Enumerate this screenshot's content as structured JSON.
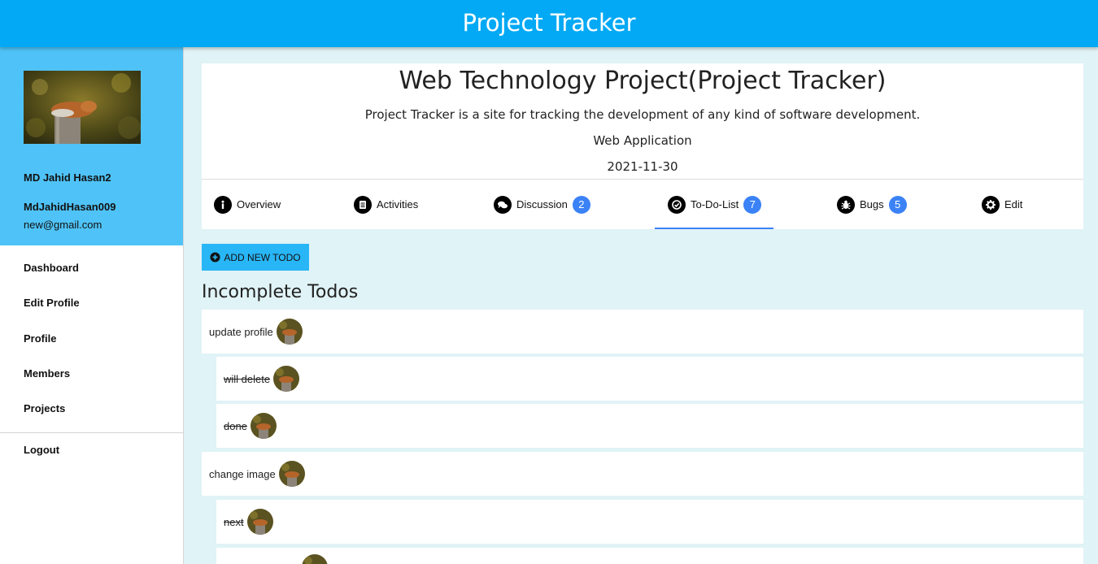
{
  "header": {
    "title": "Project Tracker"
  },
  "sidebar": {
    "profile": {
      "name": "MD Jahid Hasan2",
      "username": "MdJahidHasan009",
      "email": "new@gmail.com"
    },
    "nav": [
      {
        "label": "Dashboard"
      },
      {
        "label": "Edit Profile"
      },
      {
        "label": "Profile"
      },
      {
        "label": "Members"
      },
      {
        "label": "Projects"
      }
    ],
    "logout": "Logout"
  },
  "project": {
    "title": "Web Technology Project(Project Tracker)",
    "description": "Project Tracker is a site for tracking the development of any kind of software development.",
    "type": "Web Application",
    "date": "2021-11-30"
  },
  "tabs": [
    {
      "label": "Overview",
      "icon": "info-icon"
    },
    {
      "label": "Activities",
      "icon": "clipboard-icon"
    },
    {
      "label": "Discussion",
      "icon": "comments-icon",
      "badge": "2"
    },
    {
      "label": "To-Do-List",
      "icon": "check-circle-icon",
      "badge": "7",
      "active": true
    },
    {
      "label": "Bugs",
      "icon": "bug-icon",
      "badge": "5"
    },
    {
      "label": "Edit",
      "icon": "gear-icon"
    }
  ],
  "todos": {
    "add_button": "ADD NEW TODO",
    "section_title": "Incomplete Todos",
    "items": [
      {
        "label": "update profile",
        "done": false,
        "level": 0
      },
      {
        "label": "will delete",
        "done": true,
        "level": 1
      },
      {
        "label": "done",
        "done": true,
        "level": 1
      },
      {
        "label": "change image",
        "done": false,
        "level": 0
      },
      {
        "label": "next",
        "done": true,
        "level": 1
      }
    ]
  },
  "colors": {
    "topbar": "#03a9f4",
    "profile_bg": "#4fc3f7",
    "accent": "#3b82f6",
    "page_bg": "#e0f3f6"
  }
}
